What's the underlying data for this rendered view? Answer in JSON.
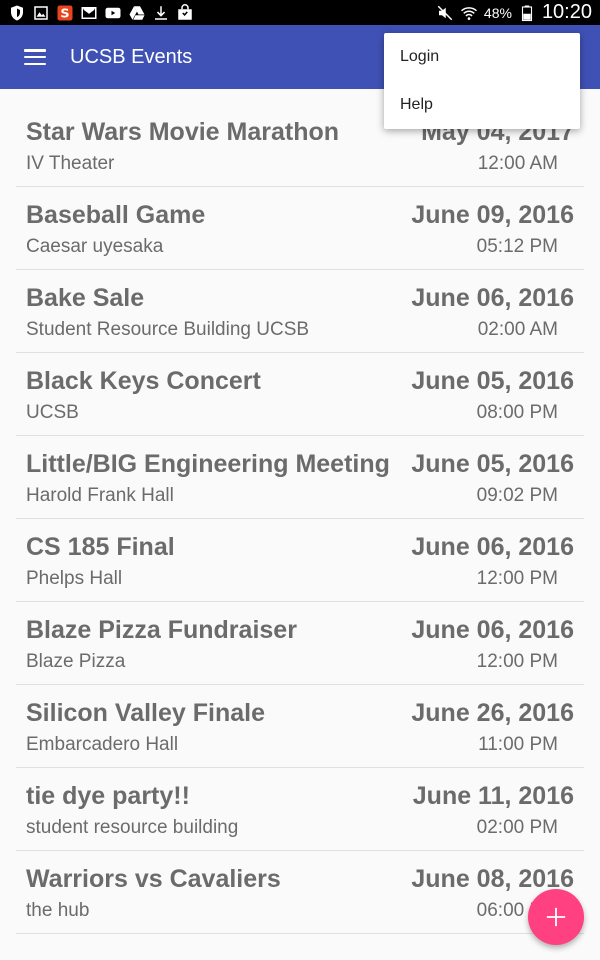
{
  "status_bar": {
    "battery_percent": "48%",
    "time": "10:20",
    "left_icons": [
      "shield-icon",
      "gallery-icon",
      "s-app-icon",
      "mail-icon",
      "youtube-icon",
      "drive-icon",
      "download-icon",
      "shopping-bag-icon"
    ],
    "right_icons": [
      "mute-icon",
      "wifi-icon",
      "battery-icon"
    ]
  },
  "app_bar": {
    "title": "UCSB Events",
    "color": "#3f51b5"
  },
  "overflow_menu": {
    "items": [
      "Login",
      "Help"
    ]
  },
  "events": [
    {
      "title": "Star Wars Movie Marathon",
      "date": "May 04, 2017",
      "location": "IV Theater",
      "time": "12:00 AM"
    },
    {
      "title": "Baseball Game",
      "date": "June 09, 2016",
      "location": "Caesar uyesaka",
      "time": "05:12 PM"
    },
    {
      "title": "Bake Sale",
      "date": "June 06, 2016",
      "location": "Student Resource Building UCSB",
      "time": "02:00 AM"
    },
    {
      "title": "Black Keys Concert",
      "date": "June 05, 2016",
      "location": "UCSB",
      "time": "08:00 PM"
    },
    {
      "title": "Little/BIG Engineering Meeting",
      "date": "June 05, 2016",
      "location": "Harold Frank Hall",
      "time": "09:02 PM"
    },
    {
      "title": "CS 185 Final",
      "date": "June 06, 2016",
      "location": "Phelps Hall",
      "time": "12:00 PM"
    },
    {
      "title": "Blaze Pizza Fundraiser",
      "date": "June 06, 2016",
      "location": "Blaze Pizza",
      "time": "12:00 PM"
    },
    {
      "title": "Silicon Valley Finale",
      "date": "June 26, 2016",
      "location": "Embarcadero Hall",
      "time": "11:00 PM"
    },
    {
      "title": "tie dye party!!",
      "date": "June 11, 2016",
      "location": "student resource building",
      "time": "02:00 PM"
    },
    {
      "title": "Warriors vs Cavaliers",
      "date": "June 08, 2016",
      "location": "the hub",
      "time": "06:00 PM"
    }
  ],
  "fab": {
    "icon": "plus-icon",
    "color": "#ff4081"
  }
}
